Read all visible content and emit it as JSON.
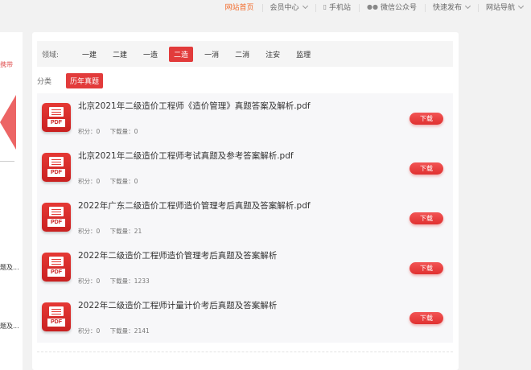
{
  "topbar": {
    "items": [
      {
        "label": "网站首页",
        "active": true,
        "chevron": false,
        "icon": ""
      },
      {
        "label": "会员中心",
        "active": false,
        "chevron": true,
        "icon": ""
      },
      {
        "label": "手机站",
        "active": false,
        "chevron": false,
        "icon": "phone-icon"
      },
      {
        "label": "微信公众号",
        "active": false,
        "chevron": false,
        "icon": "wechat-icon"
      },
      {
        "label": "快速发布",
        "active": false,
        "chevron": true,
        "icon": ""
      },
      {
        "label": "网站导航",
        "active": false,
        "chevron": true,
        "icon": ""
      }
    ]
  },
  "sidebar": {
    "promo_text": "携带",
    "snippet_1": "题及...",
    "snippet_2": "题及..."
  },
  "filters": {
    "field_label": "领域:",
    "fields": [
      {
        "label": "一建",
        "active": false
      },
      {
        "label": "二建",
        "active": false
      },
      {
        "label": "一造",
        "active": false
      },
      {
        "label": "二造",
        "active": true
      },
      {
        "label": "一消",
        "active": false
      },
      {
        "label": "二消",
        "active": false
      },
      {
        "label": "注安",
        "active": false
      },
      {
        "label": "监理",
        "active": false
      }
    ],
    "category_label": "分类",
    "category_active": "历年真题"
  },
  "files": [
    {
      "title": "北京2021年二级造价工程师《造价管理》真题答案及解析.pdf",
      "points": "积分：0",
      "downloads": "下载量：0",
      "icon_label": "PDF",
      "button": "下载"
    },
    {
      "title": "北京2021年二级造价工程师考试真题及参考答案解析.pdf",
      "points": "积分：0",
      "downloads": "下载量：0",
      "icon_label": "PDF",
      "button": "下载"
    },
    {
      "title": "2022年广东二级造价工程师造价管理考后真题及答案解析.pdf",
      "points": "积分：0",
      "downloads": "下载量：21",
      "icon_label": "PDF",
      "button": "下载"
    },
    {
      "title": "2022年二级造价工程师造价管理考后真题及答案解析",
      "points": "积分：0",
      "downloads": "下载量：1233",
      "icon_label": "PDF",
      "button": "下载"
    },
    {
      "title": "2022年二级造价工程师计量计价考后真题及答案解析",
      "points": "积分：0",
      "downloads": "下载量：2141",
      "icon_label": "PDF",
      "button": "下载"
    }
  ],
  "colors": {
    "accent": "#e23b3b",
    "nav_active": "#f26b2b"
  }
}
